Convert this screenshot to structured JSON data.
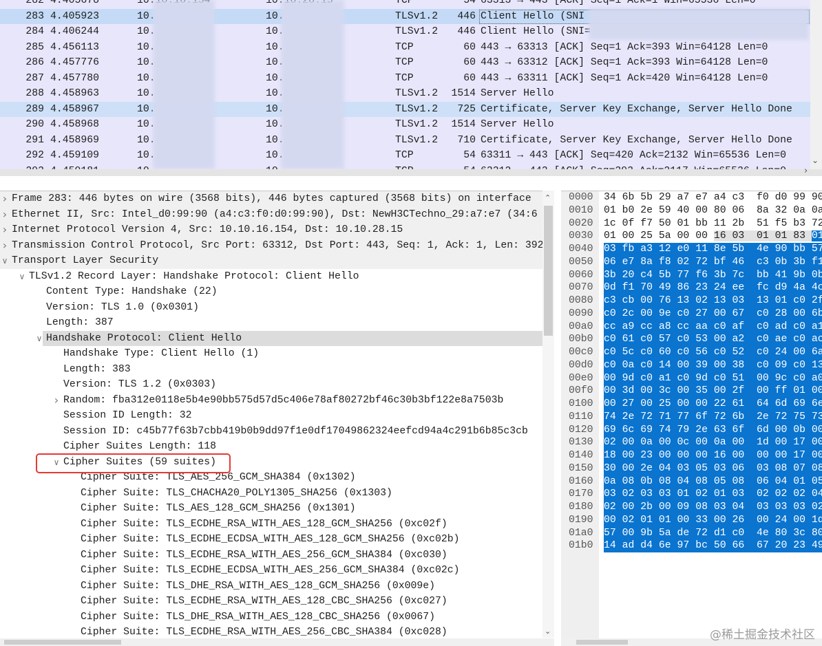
{
  "packet_list": {
    "selected_no": "283",
    "rows": [
      {
        "no": "282",
        "time": "4.405678",
        "src": "10.10.16.154",
        "dst": "10.10.28.15",
        "proto": "TCP",
        "len": "54",
        "info": "63313 → 443 [ACK] Seq=1 Ack=1 Win=65536 Len=0",
        "state": "normal"
      },
      {
        "no": "283",
        "time": "4.405923",
        "src": "10.",
        "dst": "10.",
        "proto": "TLSv1.2",
        "len": "446",
        "info": "Client Hello (SNI",
        "state": "selected"
      },
      {
        "no": "284",
        "time": "4.406244",
        "src": "10.",
        "dst": "10.",
        "proto": "TLSv1.2",
        "len": "446",
        "info": "Client Hello (SNI=",
        "state": "normal"
      },
      {
        "no": "285",
        "time": "4.456113",
        "src": "10.",
        "dst": "10.",
        "proto": "TCP",
        "len": "60",
        "info": "443 → 63313 [ACK] Seq=1 Ack=393 Win=64128 Len=0",
        "state": "normal"
      },
      {
        "no": "286",
        "time": "4.457776",
        "src": "10.",
        "dst": "10.",
        "proto": "TCP",
        "len": "60",
        "info": "443 → 63312 [ACK] Seq=1 Ack=393 Win=64128 Len=0",
        "state": "normal"
      },
      {
        "no": "287",
        "time": "4.457780",
        "src": "10.",
        "dst": "10.",
        "proto": "TCP",
        "len": "60",
        "info": "443 → 63311 [ACK] Seq=1 Ack=420 Win=64128 Len=0",
        "state": "normal"
      },
      {
        "no": "288",
        "time": "4.458963",
        "src": "10.",
        "dst": "10.",
        "proto": "TLSv1.2",
        "len": "1514",
        "info": "Server Hello",
        "state": "normal"
      },
      {
        "no": "289",
        "time": "4.458967",
        "src": "10.",
        "dst": "10.",
        "proto": "TLSv1.2",
        "len": "725",
        "info": "Certificate, Server Key Exchange, Server Hello Done",
        "state": "related"
      },
      {
        "no": "290",
        "time": "4.458968",
        "src": "10.",
        "dst": "10.",
        "proto": "TLSv1.2",
        "len": "1514",
        "info": "Server Hello",
        "state": "normal"
      },
      {
        "no": "291",
        "time": "4.458969",
        "src": "10.",
        "dst": "10.",
        "proto": "TLSv1.2",
        "len": "710",
        "info": "Certificate, Server Key Exchange, Server Hello Done",
        "state": "normal"
      },
      {
        "no": "292",
        "time": "4.459109",
        "src": "10.",
        "dst": "10.",
        "proto": "TCP",
        "len": "54",
        "info": "63311 → 443 [ACK] Seq=420 Ack=2132 Win=65536 Len=0",
        "state": "normal"
      },
      {
        "no": "293",
        "time": "4.459181",
        "src": "10.",
        "dst": "10.",
        "proto": "TCP",
        "len": "54",
        "info": "63312 → 443 [ACK] Seq=393 Ack=2117 Win=65536 Len=0",
        "state": "normal"
      }
    ]
  },
  "details_tree": {
    "rows": [
      {
        "level": 0,
        "expander": "collapsed",
        "text": "Frame 283: 446 bytes on wire (3568 bits), 446 bytes captured (3568 bits) on interface",
        "bg": "header"
      },
      {
        "level": 0,
        "expander": "collapsed",
        "text": "Ethernet II, Src: Intel_d0:99:90 (a4:c3:f0:d0:99:90), Dst: NewH3CTechno_29:a7:e7 (34:6",
        "bg": "header"
      },
      {
        "level": 0,
        "expander": "collapsed",
        "text": "Internet Protocol Version 4, Src: 10.10.16.154, Dst: 10.10.28.15",
        "bg": "header"
      },
      {
        "level": 0,
        "expander": "collapsed",
        "text": "Transmission Control Protocol, Src Port: 63312, Dst Port: 443, Seq: 1, Ack: 1, Len: 392",
        "bg": "header"
      },
      {
        "level": 0,
        "expander": "expanded",
        "text": "Transport Layer Security",
        "bg": "header"
      },
      {
        "level": 1,
        "expander": "expanded",
        "text": "TLSv1.2 Record Layer: Handshake Protocol: Client Hello",
        "bg": "none"
      },
      {
        "level": 2,
        "expander": "none",
        "text": "Content Type: Handshake (22)",
        "bg": "none"
      },
      {
        "level": 2,
        "expander": "none",
        "text": "Version: TLS 1.0 (0x0301)",
        "bg": "none"
      },
      {
        "level": 2,
        "expander": "none",
        "text": "Length: 387",
        "bg": "none"
      },
      {
        "level": 2,
        "expander": "expanded",
        "text": "Handshake Protocol: Client Hello",
        "bg": "selected"
      },
      {
        "level": 3,
        "expander": "none",
        "text": "Handshake Type: Client Hello (1)",
        "bg": "none"
      },
      {
        "level": 3,
        "expander": "none",
        "text": "Length: 383",
        "bg": "none"
      },
      {
        "level": 3,
        "expander": "none",
        "text": "Version: TLS 1.2 (0x0303)",
        "bg": "none"
      },
      {
        "level": 3,
        "expander": "collapsed",
        "text": "Random: fba312e0118e5b4e90bb575d57d5c406e78af80272bf46c30b3bf122e8a7503b",
        "bg": "none"
      },
      {
        "level": 3,
        "expander": "none",
        "text": "Session ID Length: 32",
        "bg": "none"
      },
      {
        "level": 3,
        "expander": "none",
        "text": "Session ID: c45b77f63b7cbb419b0b9dd97f1e0df17049862324eefcd94a4c291b6b85c3cb",
        "bg": "none"
      },
      {
        "level": 3,
        "expander": "none",
        "text": "Cipher Suites Length: 118",
        "bg": "none"
      },
      {
        "level": 3,
        "expander": "expanded",
        "text": "Cipher Suites (59 suites)",
        "bg": "none"
      },
      {
        "level": 4,
        "expander": "none",
        "text": "Cipher Suite: TLS_AES_256_GCM_SHA384 (0x1302)",
        "bg": "none"
      },
      {
        "level": 4,
        "expander": "none",
        "text": "Cipher Suite: TLS_CHACHA20_POLY1305_SHA256 (0x1303)",
        "bg": "none"
      },
      {
        "level": 4,
        "expander": "none",
        "text": "Cipher Suite: TLS_AES_128_GCM_SHA256 (0x1301)",
        "bg": "none"
      },
      {
        "level": 4,
        "expander": "none",
        "text": "Cipher Suite: TLS_ECDHE_RSA_WITH_AES_128_GCM_SHA256 (0xc02f)",
        "bg": "none"
      },
      {
        "level": 4,
        "expander": "none",
        "text": "Cipher Suite: TLS_ECDHE_ECDSA_WITH_AES_128_GCM_SHA256 (0xc02b)",
        "bg": "none"
      },
      {
        "level": 4,
        "expander": "none",
        "text": "Cipher Suite: TLS_ECDHE_RSA_WITH_AES_256_GCM_SHA384 (0xc030)",
        "bg": "none"
      },
      {
        "level": 4,
        "expander": "none",
        "text": "Cipher Suite: TLS_ECDHE_ECDSA_WITH_AES_256_GCM_SHA384 (0xc02c)",
        "bg": "none"
      },
      {
        "level": 4,
        "expander": "none",
        "text": "Cipher Suite: TLS_DHE_RSA_WITH_AES_128_GCM_SHA256 (0x009e)",
        "bg": "none"
      },
      {
        "level": 4,
        "expander": "none",
        "text": "Cipher Suite: TLS_ECDHE_RSA_WITH_AES_128_CBC_SHA256 (0xc027)",
        "bg": "none"
      },
      {
        "level": 4,
        "expander": "none",
        "text": "Cipher Suite: TLS_DHE_RSA_WITH_AES_128_CBC_SHA256 (0x0067)",
        "bg": "none"
      },
      {
        "level": 4,
        "expander": "none",
        "text": "Cipher Suite: TLS_ECDHE_RSA_WITH_AES_256_CBC_SHA384 (0xc028)",
        "bg": "none"
      }
    ]
  },
  "hex_dump": {
    "rows": [
      {
        "offset": "0000",
        "segments": [
          {
            "text": "34 6b 5b 29 a7 e7 a4 c3  f0 d0 99 90",
            "hl": "none"
          }
        ]
      },
      {
        "offset": "0010",
        "segments": [
          {
            "text": "01 b0 2e 59 40 00 80 06  8a 32 0a 0a",
            "hl": "none"
          }
        ]
      },
      {
        "offset": "0020",
        "segments": [
          {
            "text": "1c 0f f7 50 01 bb 11 2b  51 f5 b3 72",
            "hl": "none"
          }
        ]
      },
      {
        "offset": "0030",
        "segments": [
          {
            "text": "01 00 25 5a 00 00 ",
            "hl": "none"
          },
          {
            "text": "16 03  01 01 83 ",
            "hl": "gray"
          },
          {
            "text": "01",
            "hl": "blue"
          }
        ]
      },
      {
        "offset": "0040",
        "segments": [
          {
            "text": "03 fb a3 12 e0 11 8e 5b  4e 90 bb 57",
            "hl": "blue"
          }
        ]
      },
      {
        "offset": "0050",
        "segments": [
          {
            "text": "06 e7 8a f8 02 72 bf 46  c3 0b 3b f1",
            "hl": "blue"
          }
        ]
      },
      {
        "offset": "0060",
        "segments": [
          {
            "text": "3b 20 c4 5b 77 f6 3b 7c  bb 41 9b 0b",
            "hl": "blue"
          }
        ]
      },
      {
        "offset": "0070",
        "segments": [
          {
            "text": "0d f1 70 49 86 23 24 ee  fc d9 4a 4c",
            "hl": "blue"
          }
        ]
      },
      {
        "offset": "0080",
        "segments": [
          {
            "text": "c3 cb 00 76 13 02 13 03  13 01 c0 2f",
            "hl": "blue"
          }
        ]
      },
      {
        "offset": "0090",
        "segments": [
          {
            "text": "c0 2c 00 9e c0 27 00 67  c0 28 00 6b",
            "hl": "blue"
          }
        ]
      },
      {
        "offset": "00a0",
        "segments": [
          {
            "text": "cc a9 cc a8 cc aa c0 af  c0 ad c0 a1",
            "hl": "blue"
          }
        ]
      },
      {
        "offset": "00b0",
        "segments": [
          {
            "text": "c0 61 c0 57 c0 53 00 a2  c0 ae c0 ac",
            "hl": "blue"
          }
        ]
      },
      {
        "offset": "00c0",
        "segments": [
          {
            "text": "c0 5c c0 60 c0 56 c0 52  c0 24 00 6a",
            "hl": "blue"
          }
        ]
      },
      {
        "offset": "00d0",
        "segments": [
          {
            "text": "c0 0a c0 14 00 39 00 38  c0 09 c0 13",
            "hl": "blue"
          }
        ]
      },
      {
        "offset": "00e0",
        "segments": [
          {
            "text": "00 9d c0 a1 c0 9d c0 51  00 9c c0 a0",
            "hl": "blue"
          }
        ]
      },
      {
        "offset": "00f0",
        "segments": [
          {
            "text": "00 3d 00 3c 00 35 00 2f  00 ff 01 00",
            "hl": "blue"
          }
        ]
      },
      {
        "offset": "0100",
        "segments": [
          {
            "text": "00 27 00 25 00 00 22 61  64 6d 69 6e",
            "hl": "blue"
          }
        ]
      },
      {
        "offset": "0110",
        "segments": [
          {
            "text": "74 2e 72 71 77 6f 72 6b  2e 72 75 73",
            "hl": "blue"
          }
        ]
      },
      {
        "offset": "0120",
        "segments": [
          {
            "text": "69 6c 69 74 79 2e 63 6f  6d 00 0b 00",
            "hl": "blue"
          }
        ]
      },
      {
        "offset": "0130",
        "segments": [
          {
            "text": "02 00 0a 00 0c 00 0a 00  1d 00 17 00",
            "hl": "blue"
          }
        ]
      },
      {
        "offset": "0140",
        "segments": [
          {
            "text": "18 00 23 00 00 00 16 00  00 00 17 00",
            "hl": "blue"
          }
        ]
      },
      {
        "offset": "0150",
        "segments": [
          {
            "text": "30 00 2e 04 03 05 03 06  03 08 07 08",
            "hl": "blue"
          }
        ]
      },
      {
        "offset": "0160",
        "segments": [
          {
            "text": "0a 08 0b 08 04 08 05 08  06 04 01 05",
            "hl": "blue"
          }
        ]
      },
      {
        "offset": "0170",
        "segments": [
          {
            "text": "03 02 03 03 01 02 01 03  02 02 02 04",
            "hl": "blue"
          }
        ]
      },
      {
        "offset": "0180",
        "segments": [
          {
            "text": "02 00 2b 00 09 08 03 04  03 03 03 02",
            "hl": "blue"
          }
        ]
      },
      {
        "offset": "0190",
        "segments": [
          {
            "text": "00 02 01 01 00 33 00 26  00 24 00 1d",
            "hl": "blue"
          }
        ]
      },
      {
        "offset": "01a0",
        "segments": [
          {
            "text": "57 00 9b 5a de 72 d1 c0  4e 80 3c 80",
            "hl": "blue"
          }
        ]
      },
      {
        "offset": "01b0",
        "segments": [
          {
            "text": "14 ad d4 6e 97 bc 50 66  67 20 23 49",
            "hl": "blue"
          }
        ]
      }
    ]
  },
  "annotation": {
    "color": "#e53935",
    "target": "Cipher Suites (59 suites)"
  },
  "colors": {
    "packet_bg": "#e8e6fb",
    "selected_row": "#c4daf6",
    "related_row": "#cde0f8",
    "byte_highlight": "#0a74cf"
  },
  "icons": {
    "collapsed": "chevron-right-icon",
    "expanded": "chevron-down-icon"
  },
  "watermark": "@稀土掘金技术社区"
}
